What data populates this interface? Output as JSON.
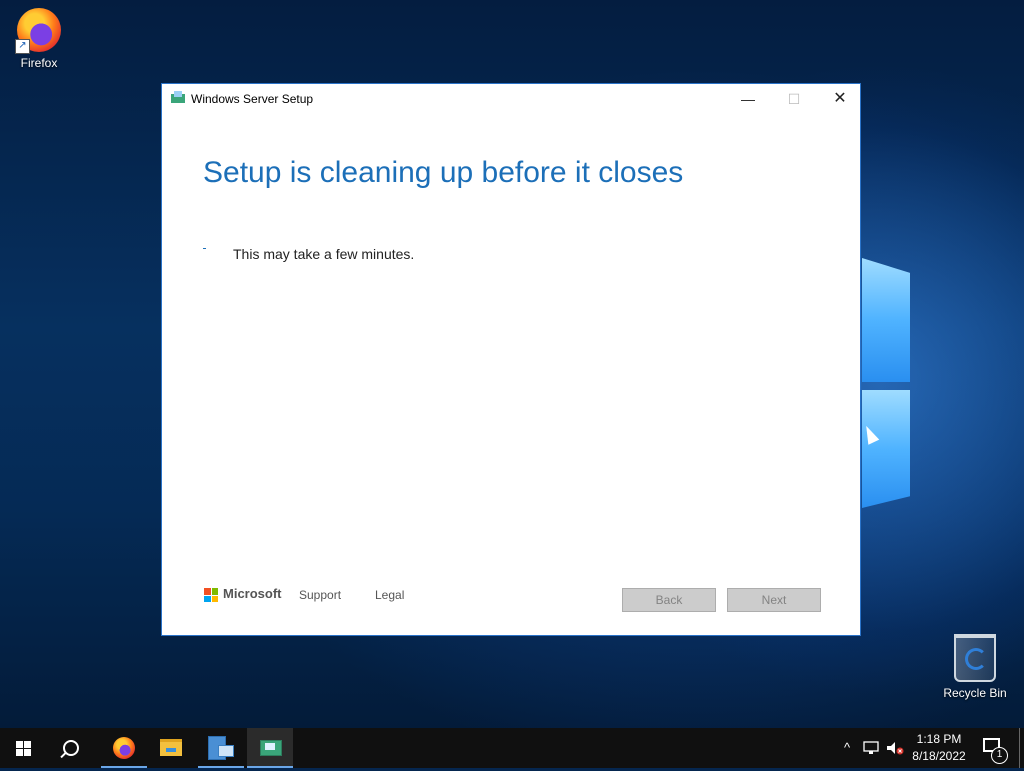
{
  "desktop": {
    "icons": [
      {
        "label": "Firefox"
      },
      {
        "label": "Recycle Bin"
      }
    ]
  },
  "window": {
    "title": "Windows Server Setup",
    "controls": {
      "minimize": "—",
      "maximize": "☐",
      "close": "✕"
    },
    "heading": "Setup is cleaning up before it closes",
    "message": "This may take a few minutes.",
    "footer": {
      "brand": "Microsoft",
      "support_link": "Support",
      "legal_link": "Legal",
      "back_button": "Back",
      "next_button": "Next"
    }
  },
  "taskbar": {
    "items": [
      {
        "icon": "windows-start-icon"
      },
      {
        "icon": "search-icon"
      },
      {
        "icon": "firefox-icon"
      },
      {
        "icon": "file-explorer-icon"
      },
      {
        "icon": "server-manager-icon"
      },
      {
        "icon": "windows-setup-icon",
        "active": true
      }
    ],
    "tray": {
      "chevron": "^",
      "time": "1:18 PM",
      "date": "8/18/2022",
      "notification_count": "1"
    }
  },
  "colors": {
    "heading": "#1c6fb8",
    "window_border": "#2a73c9",
    "button_disabled_bg": "#cccccc",
    "taskbar": "#101010"
  }
}
